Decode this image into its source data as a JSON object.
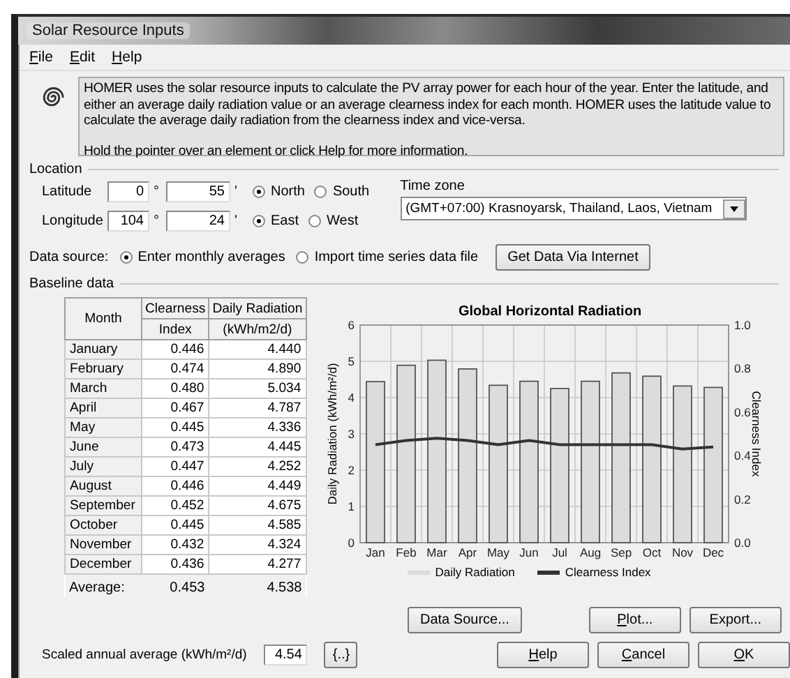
{
  "window": {
    "title": "Solar Resource Inputs"
  },
  "menu": [
    {
      "label": "File"
    },
    {
      "label": "Edit"
    },
    {
      "label": "Help"
    }
  ],
  "info": {
    "text": "HOMER uses the solar resource inputs to calculate the PV array power for each hour of the year. Enter the latitude, and either an average daily radiation value or an average clearness index for each month. HOMER uses the latitude value to calculate the average daily radiation from the clearness index and vice-versa.",
    "hint": "Hold the pointer over an element or click Help for more information."
  },
  "location": {
    "title": "Location",
    "rows": [
      {
        "label": "Latitude",
        "degrees": "0",
        "degree_mark": "°",
        "minutes": "55",
        "minute_mark": "'",
        "options": [
          {
            "label": "North",
            "selected": true
          },
          {
            "label": "South",
            "selected": false
          }
        ]
      },
      {
        "label": "Longitude",
        "degrees": "104",
        "degree_mark": "°",
        "minutes": "24",
        "minute_mark": "'",
        "options": [
          {
            "label": "East",
            "selected": true
          },
          {
            "label": "West",
            "selected": false
          }
        ]
      }
    ],
    "time_zone": {
      "label": "Time zone",
      "value": "(GMT+07:00) Krasnoyarsk, Thailand, Laos, Vietnam"
    }
  },
  "data_source": {
    "label": "Data source:",
    "options": [
      {
        "label": "Enter monthly averages",
        "selected": true
      },
      {
        "label": "Import time series data file",
        "selected": false
      }
    ],
    "button": "Get Data Via Internet"
  },
  "baseline": {
    "title": "Baseline data",
    "table": {
      "columns": [
        "Month",
        "Clearness",
        "Index",
        "Daily Radiation",
        "(kWh/m2/d)"
      ],
      "rows": [
        {
          "month": "January",
          "clearness": "0.446",
          "radiation": "4.440"
        },
        {
          "month": "February",
          "clearness": "0.474",
          "radiation": "4.890"
        },
        {
          "month": "March",
          "clearness": "0.480",
          "radiation": "5.034"
        },
        {
          "month": "April",
          "clearness": "0.467",
          "radiation": "4.787"
        },
        {
          "month": "May",
          "clearness": "0.445",
          "radiation": "4.336"
        },
        {
          "month": "June",
          "clearness": "0.473",
          "radiation": "4.445"
        },
        {
          "month": "July",
          "clearness": "0.447",
          "radiation": "4.252"
        },
        {
          "month": "August",
          "clearness": "0.446",
          "radiation": "4.449"
        },
        {
          "month": "September",
          "clearness": "0.452",
          "radiation": "4.675"
        },
        {
          "month": "October",
          "clearness": "0.445",
          "radiation": "4.585"
        },
        {
          "month": "November",
          "clearness": "0.432",
          "radiation": "4.324"
        },
        {
          "month": "December",
          "clearness": "0.436",
          "radiation": "4.277"
        }
      ],
      "average": {
        "label": "Average:",
        "clearness": "0.453",
        "radiation": "4.538"
      }
    },
    "scaled": {
      "label": "Scaled annual average (kWh/m²/d)",
      "value": "4.54",
      "button": "{..}"
    },
    "chart_data": {
      "type": "bar",
      "title": "Global Horizontal Radiation",
      "ylabel": "Daily Radiation (kWh/m²/d)",
      "categories": [
        "Jan",
        "Feb",
        "Mar",
        "Apr",
        "May",
        "Jun",
        "Jul",
        "Aug",
        "Sep",
        "Oct",
        "Nov",
        "Dec"
      ],
      "ylim": [
        0,
        6
      ],
      "yticks": [
        0,
        1,
        2,
        3,
        4,
        5,
        6
      ],
      "grid": true,
      "legend": "bottom",
      "y2lim": [
        0,
        1
      ],
      "y2label": "Clearness Index",
      "y2ticks": [
        {
          "value": 0,
          "label": "0.0"
        },
        {
          "value": 0.2,
          "label": "0.2"
        },
        {
          "value": 0.4,
          "label": "0.4"
        },
        {
          "value": 0.6,
          "label": "0.6"
        },
        {
          "value": 0.8,
          "label": "0.8"
        },
        {
          "value": 1,
          "label": "1.0"
        }
      ],
      "series": [
        {
          "name": "Daily Radiation",
          "type": "bar",
          "color": "#dcdcdc",
          "values": [
            4.44,
            4.89,
            5.03,
            4.79,
            4.34,
            4.45,
            4.25,
            4.45,
            4.68,
            4.59,
            4.32,
            4.28
          ]
        },
        {
          "name": "Clearness Index",
          "type": "line",
          "axis": "y2",
          "color": "#333333",
          "values": [
            0.45,
            0.47,
            0.48,
            0.47,
            0.45,
            0.47,
            0.45,
            0.45,
            0.45,
            0.45,
            0.43,
            0.44
          ]
        }
      ]
    }
  },
  "buttons": [
    {
      "label": "Data Source...",
      "mnemonic": false
    },
    {
      "label": "Plot...",
      "mnemonic": true
    },
    {
      "label": "Export...",
      "mnemonic": false
    },
    {
      "label": "Help",
      "mnemonic": true
    },
    {
      "label": "Cancel",
      "mnemonic": true
    },
    {
      "label": "OK",
      "mnemonic": true
    }
  ]
}
